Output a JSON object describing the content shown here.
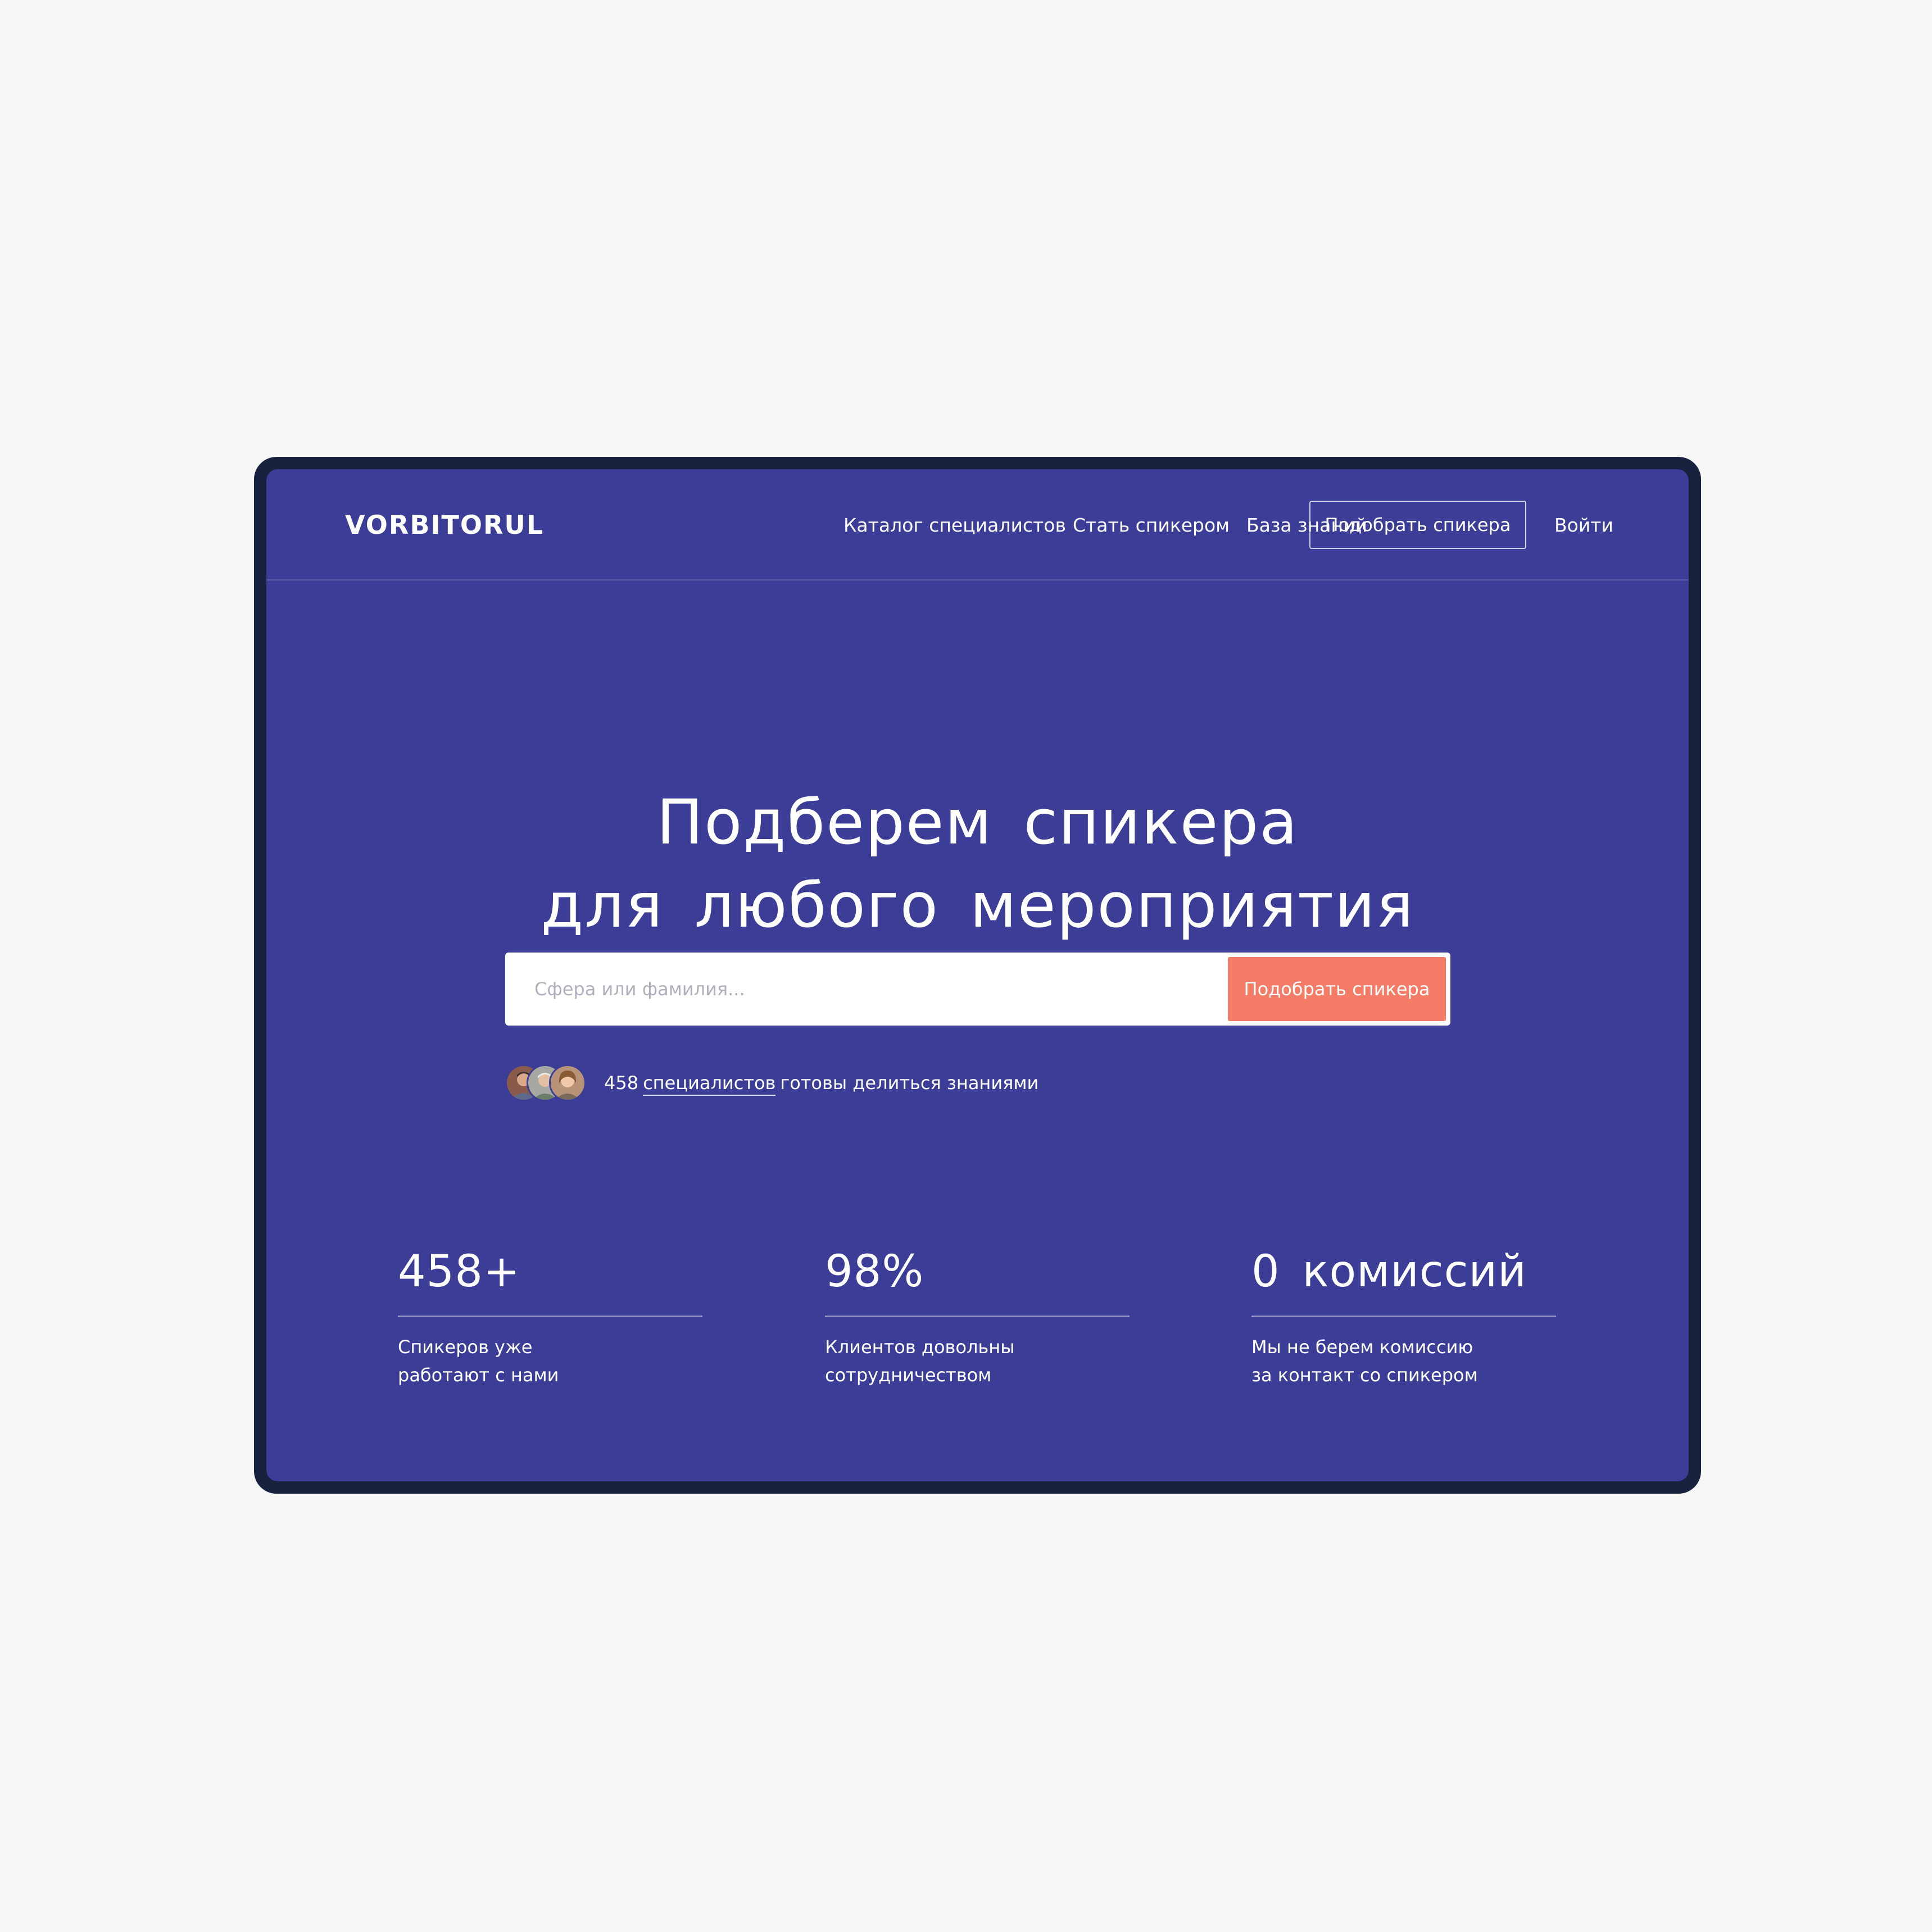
{
  "header": {
    "logo": "VORBITORUL",
    "nav": [
      {
        "label": "Каталог специалистов"
      },
      {
        "label": "Стать спикером"
      },
      {
        "label": "База знаний"
      }
    ],
    "cta_label": "Подобрать спикера",
    "login_label": "Войти"
  },
  "hero": {
    "title_line1": "Подберем спикера",
    "title_line2": "для любого мероприятия",
    "search": {
      "placeholder": "Сфера или фамилия...",
      "value": "",
      "button_label": "Подобрать спикера"
    },
    "social_proof": {
      "count": "458",
      "link_text": "специалистов",
      "suffix": "готовы делиться знаниями"
    }
  },
  "stats": [
    {
      "value": "458+",
      "desc_line1": "Спикеров уже",
      "desc_line2": "работают с нами"
    },
    {
      "value": "98%",
      "desc_line1": "Клиентов довольны",
      "desc_line2": "сотрудничеством"
    },
    {
      "value": "0 комиссий",
      "desc_line1": "Мы не берем комиссию",
      "desc_line2": "за контакт со спикером"
    }
  ],
  "colors": {
    "page_background": "#f6f6f7",
    "device_frame": "#17223f",
    "primary_background": "#3b3d96",
    "accent_button": "#f47b66",
    "text": "#ffffff"
  },
  "icons": {
    "avatars": [
      "avatar-person-1",
      "avatar-person-2",
      "avatar-person-3"
    ]
  }
}
